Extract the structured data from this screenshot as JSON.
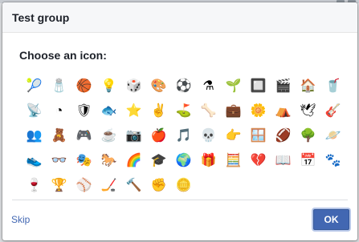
{
  "dialog": {
    "title": "Test group",
    "prompt": "Choose an icon:",
    "skip_label": "Skip",
    "ok_label": "OK"
  },
  "colors": {
    "accent": "#4267b2",
    "title_text": "#1d2129",
    "header_bg": "#f6f7f9"
  },
  "icons": [
    {
      "name": "tennis-ball-icon",
      "glyph": "🎾"
    },
    {
      "name": "salt-shaker-icon",
      "glyph": "🧂"
    },
    {
      "name": "basketball-icon",
      "glyph": "🏀"
    },
    {
      "name": "light-bulb-icon",
      "glyph": "💡"
    },
    {
      "name": "dice-icon",
      "glyph": "🎲"
    },
    {
      "name": "paint-palette-icon",
      "glyph": "🎨"
    },
    {
      "name": "soccer-ball-icon",
      "glyph": "⚽"
    },
    {
      "name": "potion-flask-icon",
      "glyph": "⚗"
    },
    {
      "name": "seedling-icon",
      "glyph": "🌱"
    },
    {
      "name": "chip-icon",
      "glyph": "🔲"
    },
    {
      "name": "clapperboard-icon",
      "glyph": "🎬"
    },
    {
      "name": "house-icon",
      "glyph": "🏠"
    },
    {
      "name": "red-cup-icon",
      "glyph": "🥤"
    },
    {
      "name": "satellite-icon",
      "glyph": "📡"
    },
    {
      "name": "pie-chart-icon",
      "glyph": "◔"
    },
    {
      "name": "shield-icon",
      "glyph": "🛡"
    },
    {
      "name": "fish-icon",
      "glyph": "🐟"
    },
    {
      "name": "star-badge-icon",
      "glyph": "⭐"
    },
    {
      "name": "peace-hand-icon",
      "glyph": "✌"
    },
    {
      "name": "golf-flag-icon",
      "glyph": "⛳"
    },
    {
      "name": "bone-icon",
      "glyph": "🦴"
    },
    {
      "name": "briefcase-icon",
      "glyph": "💼"
    },
    {
      "name": "flower-icon",
      "glyph": "🌼"
    },
    {
      "name": "tent-icon",
      "glyph": "⛺"
    },
    {
      "name": "dove-icon",
      "glyph": "🕊"
    },
    {
      "name": "guitar-icon",
      "glyph": "🎸"
    },
    {
      "name": "group-icon",
      "glyph": "👥"
    },
    {
      "name": "teddy-bear-icon",
      "glyph": "🧸"
    },
    {
      "name": "game-controller-icon",
      "glyph": "🎮"
    },
    {
      "name": "coffee-cup-icon",
      "glyph": "☕"
    },
    {
      "name": "camera-icon",
      "glyph": "📷"
    },
    {
      "name": "apple-icon",
      "glyph": "🍎"
    },
    {
      "name": "music-note-icon",
      "glyph": "🎵"
    },
    {
      "name": "skull-icon",
      "glyph": "💀"
    },
    {
      "name": "pointing-hand-icon",
      "glyph": "👉"
    },
    {
      "name": "window-icon",
      "glyph": "🪟"
    },
    {
      "name": "football-icon",
      "glyph": "🏈"
    },
    {
      "name": "tree-icon",
      "glyph": "🌳"
    },
    {
      "name": "planet-icon",
      "glyph": "🪐"
    },
    {
      "name": "sneaker-icon",
      "glyph": "👟"
    },
    {
      "name": "glasses-icon",
      "glyph": "👓"
    },
    {
      "name": "theater-masks-icon",
      "glyph": "🎭"
    },
    {
      "name": "horse-icon",
      "glyph": "🐎"
    },
    {
      "name": "rainbow-icon",
      "glyph": "🌈"
    },
    {
      "name": "graduation-cap-icon",
      "glyph": "🎓"
    },
    {
      "name": "globe-icon",
      "glyph": "🌍"
    },
    {
      "name": "gift-icon",
      "glyph": "🎁"
    },
    {
      "name": "calculator-icon",
      "glyph": "🧮"
    },
    {
      "name": "broken-heart-icon",
      "glyph": "💔"
    },
    {
      "name": "open-book-icon",
      "glyph": "📖"
    },
    {
      "name": "calendar-grid-icon",
      "glyph": "📅"
    },
    {
      "name": "paw-print-icon",
      "glyph": "🐾"
    },
    {
      "name": "wine-glass-icon",
      "glyph": "🍷"
    },
    {
      "name": "trophy-icon",
      "glyph": "🏆"
    },
    {
      "name": "baseball-icon",
      "glyph": "⚾"
    },
    {
      "name": "hockey-puck-icon",
      "glyph": "🏒"
    },
    {
      "name": "gavel-icon",
      "glyph": "🔨"
    },
    {
      "name": "raised-fist-icon",
      "glyph": "✊"
    },
    {
      "name": "gold-coin-icon",
      "glyph": "🪙"
    }
  ]
}
